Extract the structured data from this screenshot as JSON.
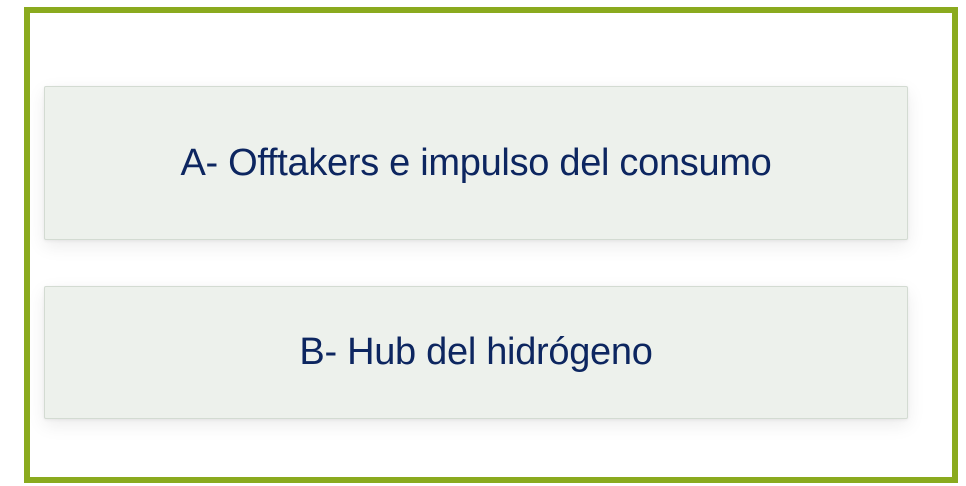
{
  "options": [
    {
      "label": "A- Offtakers e impulso del consumo"
    },
    {
      "label": "B- Hub del hidrógeno"
    }
  ],
  "colors": {
    "frame_border": "#8aaa1e",
    "card_background": "#edf1ec",
    "label_text": "#0d2660"
  }
}
